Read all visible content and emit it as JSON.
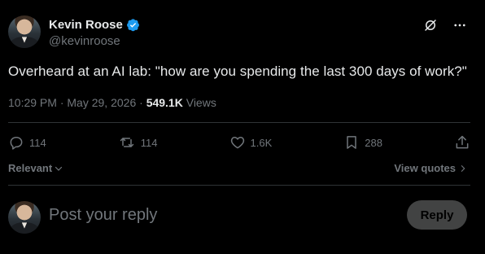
{
  "author": {
    "name": "Kevin Roose",
    "handle": "@kevinroose",
    "verified": true
  },
  "tweet": {
    "text": "Overheard at an AI lab: \"how are you spending the last 300 days of work?\"",
    "time": "10:29 PM",
    "separator": "·",
    "date": "May 29, 2026",
    "views_count": "549.1K",
    "views_label": "Views"
  },
  "actions": {
    "reply_count": "114",
    "repost_count": "114",
    "like_count": "1.6K",
    "bookmark_count": "288"
  },
  "sort": {
    "label": "Relevant"
  },
  "view_quotes_label": "View quotes",
  "composer": {
    "placeholder": "Post your reply",
    "reply_button": "Reply"
  },
  "colors": {
    "background": "#000000",
    "text_primary": "#e7e9ea",
    "text_secondary": "#71767b",
    "verified_badge": "#1d9bf0",
    "divider": "#2f3336"
  },
  "icons": [
    "verified-badge-icon",
    "grok-icon",
    "more-icon",
    "reply-icon",
    "repost-icon",
    "like-icon",
    "bookmark-icon",
    "share-icon",
    "chevron-down-icon",
    "chevron-right-icon"
  ]
}
